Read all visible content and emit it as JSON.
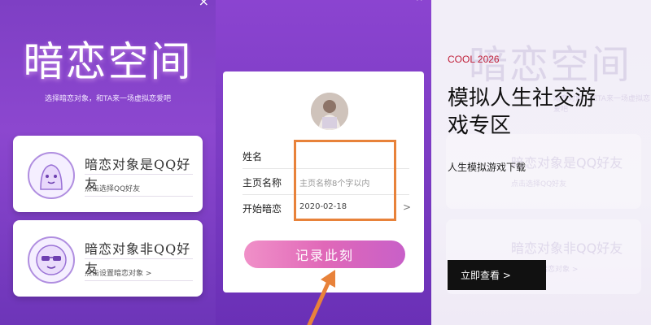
{
  "left_panel": {
    "close_glyph": "×",
    "app_title": "暗恋空间",
    "subtitle": "选择暗恋对象，和TA来一场虚拟恋爱吧",
    "cards": [
      {
        "title": "暗恋对象是QQ好友",
        "sub": "点击选择QQ好友",
        "icon": "ghost-mascot-icon"
      },
      {
        "title": "暗恋对象非QQ好友",
        "sub": "点击设置暗恋对象 >",
        "icon": "sunglasses-face-icon"
      }
    ]
  },
  "middle_panel": {
    "close_glyph": "×",
    "avatar": "profile-photo",
    "fields": [
      {
        "label": "姓名",
        "value": ""
      },
      {
        "label": "主页名称",
        "value": "主页名称8个字以内"
      },
      {
        "label": "开始暗恋",
        "value": "2020-02-18",
        "chevron": ">"
      }
    ],
    "record_button": "记录此刻",
    "highlight_color": "#e8823a"
  },
  "ad_panel": {
    "tag": "COOL 2026",
    "headline": "模拟人生社交游戏专区",
    "description": "人生模拟游戏下载",
    "button": "立即查看 >",
    "ghost_title": "暗恋空间",
    "ghost_subtitle": "暗恋对象，和TA来一场虚拟恋爱吧",
    "ghost_cards": [
      {
        "title": "暗恋对象是QQ好友",
        "sub": "点击选择QQ好友"
      },
      {
        "title": "暗恋对象非QQ好友",
        "sub": "点击设置暗恋对象 >"
      }
    ]
  }
}
